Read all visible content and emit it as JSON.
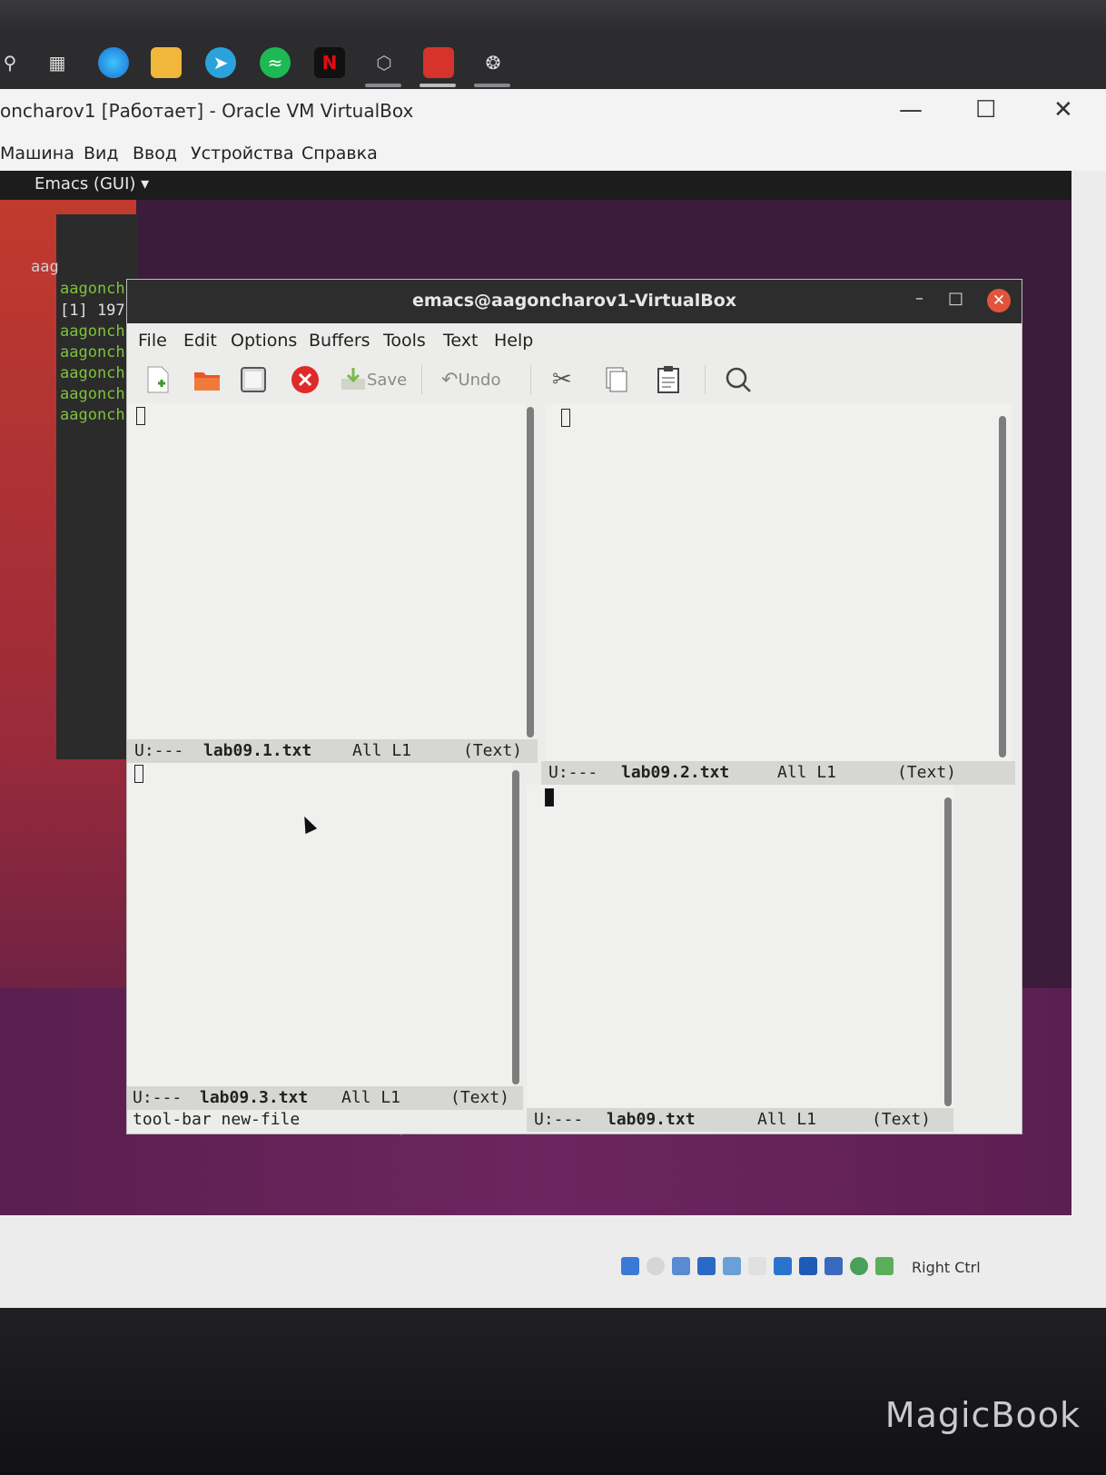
{
  "host": {
    "taskbar": {
      "icons": [
        "search-icon",
        "task-view-icon",
        "edge-icon",
        "file-explorer-icon",
        "telegram-icon",
        "spotify-icon",
        "netflix-icon",
        "virtualbox-icon",
        "app-icon",
        "chrome-icon"
      ]
    },
    "brand": "MagicBook"
  },
  "vbox": {
    "title": "oncharov1 [Работает] - Oracle VM VirtualBox",
    "menu": [
      "Машина",
      "Вид",
      "Ввод",
      "Устройства",
      "Справка"
    ],
    "status": {
      "host_key": "Right Ctrl"
    }
  },
  "guest": {
    "topbar": {
      "app_menu": "Emacs (GUI) ▾"
    },
    "terminal": {
      "lines": [
        {
          "text": "aag",
          "color": "#cfcfcf"
        },
        {
          "text": "aagonch",
          "color": "#7ec23a"
        },
        {
          "text": "[1] 197",
          "color": "#e0e0e0"
        },
        {
          "text": "aagonch",
          "color": "#7ec23a"
        },
        {
          "text": "aagonch",
          "color": "#7ec23a"
        },
        {
          "text": "aagonch",
          "color": "#7ec23a"
        },
        {
          "text": "aagonch",
          "color": "#7ec23a"
        },
        {
          "text": "aagonch",
          "color": "#7ec23a"
        }
      ]
    }
  },
  "emacs": {
    "title": "emacs@aagoncharov1-VirtualBox",
    "menu": [
      "File",
      "Edit",
      "Options",
      "Buffers",
      "Tools",
      "Text",
      "Help"
    ],
    "toolbar": {
      "save": "Save",
      "undo": "Undo"
    },
    "windows": [
      {
        "status": "U:---",
        "buffer": "lab09.1.txt",
        "position": "All L1",
        "mode": "(Text)"
      },
      {
        "status": "U:---",
        "buffer": "lab09.2.txt",
        "position": "All L1",
        "mode": "(Text)"
      },
      {
        "status": "U:---",
        "buffer": "lab09.3.txt",
        "position": "All L1",
        "mode": "(Text)"
      },
      {
        "status": "U:---",
        "buffer": "lab09.txt",
        "position": "All L1",
        "mode": "(Text)"
      }
    ],
    "echo_area": "tool-bar new-file"
  }
}
